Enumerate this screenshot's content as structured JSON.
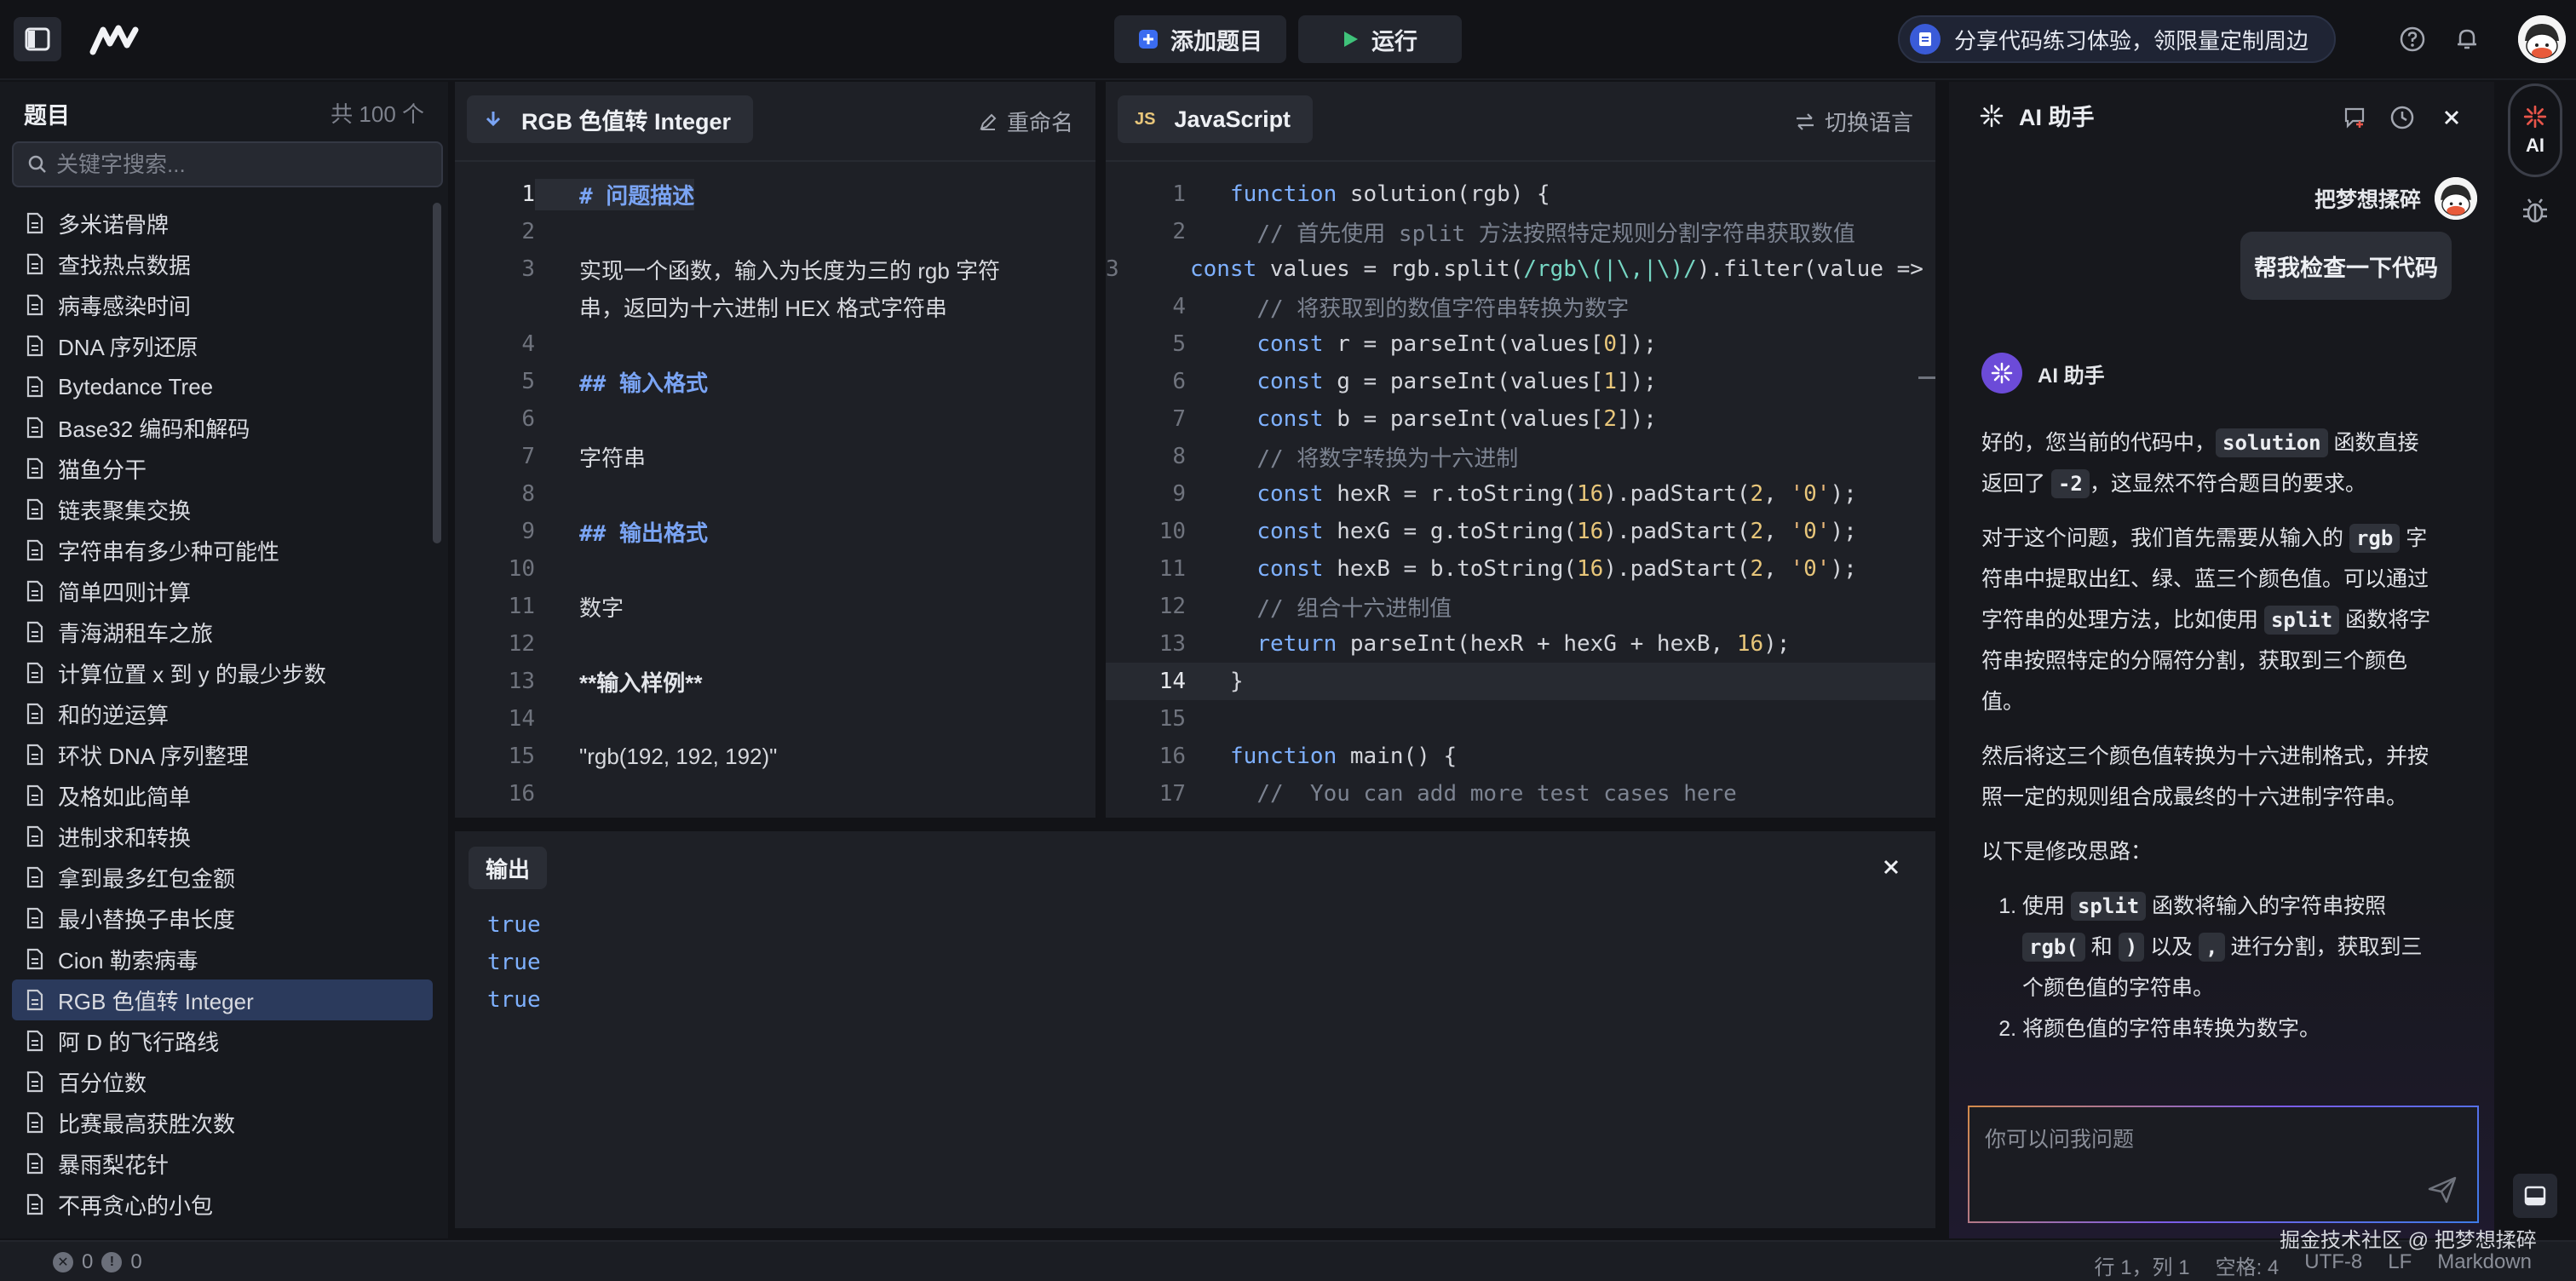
{
  "topbar": {
    "add_label": "添加题目",
    "run_label": "运行",
    "promo_text": "分享代码练习体验，领限量定制周边"
  },
  "problems": {
    "title": "题目",
    "count": "共 100 个",
    "search_placeholder": "关键字搜索...",
    "items": [
      "多米诺骨牌",
      "查找热点数据",
      "病毒感染时间",
      "DNA 序列还原",
      "Bytedance Tree",
      "Base32 编码和解码",
      "猫鱼分干",
      "链表聚集交换",
      "字符串有多少种可能性",
      "简单四则计算",
      "青海湖租车之旅",
      "计算位置 x 到 y 的最少步数",
      "和的逆运算",
      "环状 DNA 序列整理",
      "及格如此简单",
      "进制求和转换",
      "拿到最多红包金额",
      "最小替换子串长度",
      "Cion 勒索病毒",
      "RGB 色值转 Integer",
      "阿 D 的飞行路线",
      "百分位数",
      "比赛最高获胜次数",
      "暴雨梨花针",
      "不再贪心的小包"
    ],
    "active_index": 19
  },
  "desc_panel": {
    "tab_label": "RGB 色值转 Integer",
    "action_label": "重命名",
    "line_numbers": [
      "1",
      "2",
      "3",
      "",
      "4",
      "5",
      "6",
      "7",
      "8",
      "9",
      "10",
      "11",
      "12",
      "13",
      "14",
      "15",
      "16"
    ],
    "lines": [
      {
        "cls": "md-h",
        "text": "# 问题描述"
      },
      {
        "cls": "md-p",
        "text": ""
      },
      {
        "cls": "md-p",
        "text": "实现一个函数，输入为长度为三的 rgb 字符"
      },
      {
        "cls": "md-p",
        "text": "串，返回为十六进制 HEX 格式字符串"
      },
      {
        "cls": "md-p",
        "text": ""
      },
      {
        "cls": "md-h",
        "text": "## 输入格式"
      },
      {
        "cls": "md-p",
        "text": ""
      },
      {
        "cls": "md-p",
        "text": "字符串"
      },
      {
        "cls": "md-p",
        "text": ""
      },
      {
        "cls": "md-h",
        "text": "## 输出格式"
      },
      {
        "cls": "md-p",
        "text": ""
      },
      {
        "cls": "md-p",
        "text": "数字"
      },
      {
        "cls": "md-p",
        "text": ""
      },
      {
        "cls": "md-b",
        "text": "**输入样例**"
      },
      {
        "cls": "md-p",
        "text": ""
      },
      {
        "cls": "md-p",
        "text": "\"rgb(192, 192, 192)\""
      },
      {
        "cls": "md-p",
        "text": ""
      }
    ]
  },
  "code_panel": {
    "lang_badge": "JS",
    "tab_label": "JavaScript",
    "action_label": "切换语言",
    "current_line": 14,
    "lines": [
      "function solution(rgb) {",
      "  // 首先使用 split 方法按照特定规则分割字符串获取数值",
      "  const values = rgb.split(/rgb\\(|\\,|\\)/).filter(value => value !== '');",
      "  // 将获取到的数值字符串转换为数字",
      "  const r = parseInt(values[0]);",
      "  const g = parseInt(values[1]);",
      "  const b = parseInt(values[2]);",
      "  // 将数字转换为十六进制",
      "  const hexR = r.toString(16).padStart(2, '0');",
      "  const hexG = g.toString(16).padStart(2, '0');",
      "  const hexB = b.toString(16).padStart(2, '0');",
      "  // 组合十六进制值",
      "  return parseInt(hexR + hexG + hexB, 16);",
      "}",
      "",
      "function main() {",
      "  //  You can add more test cases here"
    ]
  },
  "output": {
    "tab_label": "输出",
    "lines": [
      "true",
      "true",
      "true"
    ]
  },
  "ai": {
    "title": "AI 助手",
    "user_name": "把梦想揉碎",
    "user_message": "帮我检查一下代码",
    "assistant_name": "AI 助手",
    "input_placeholder": "你可以问我问题",
    "rail_label": "AI",
    "p1": [
      "好的，您当前的代码中，",
      "solution",
      " 函数直接返回了 ",
      "-2",
      "，这显然不符合题目的要求。"
    ],
    "p2": [
      "对于这个问题，我们首先需要从输入的 ",
      "rgb",
      " 字符串中提取出红、绿、蓝三个颜色值。可以通过字符串的处理方法，比如使用 ",
      "split",
      " 函数将字符串按照特定的分隔符分割，获取到三个颜色值。"
    ],
    "p3": "然后将这三个颜色值转换为十六进制格式，并按照一定的规则组合成最终的十六进制字符串。",
    "p4": "以下是修改思路：",
    "li1": [
      "使用 ",
      "split",
      " 函数将输入的字符串按照 ",
      "rgb(",
      " 和 ",
      ")",
      " 以及 ",
      ",",
      " 进行分割，获取到三个颜色值的字符串。"
    ],
    "li2": "将颜色值的字符串转换为数字。"
  },
  "status": {
    "errors": "0",
    "warnings": "0",
    "position": "行 1，列 1",
    "spaces": "空格: 4",
    "encoding": "UTF-8",
    "eol": "LF",
    "language": "Markdown"
  },
  "watermark": "掘金技术社区 @ 把梦想揉碎"
}
